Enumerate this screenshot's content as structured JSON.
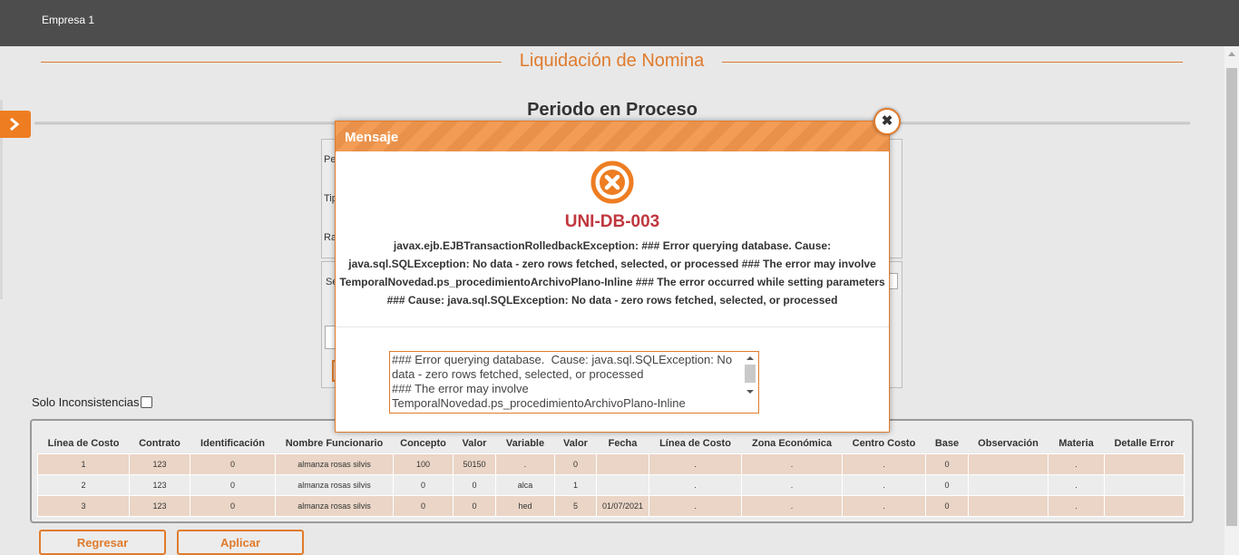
{
  "header": {
    "company": "Empresa 1"
  },
  "page": {
    "title": "Liquidación de Nomina",
    "section_title": "Periodo en Proceso"
  },
  "form_fragments": {
    "f1": "Pe",
    "f2": "Tip",
    "f3": "Ra",
    "f4": "Se"
  },
  "filter": {
    "solo_inconsistencias_label": "Solo Inconsistencias",
    "checked": false
  },
  "table": {
    "columns": [
      "Línea de Costo",
      "Contrato",
      "Identificación",
      "Nombre Funcionario",
      "Concepto",
      "Valor",
      "Variable",
      "Valor",
      "Fecha",
      "Línea de Costo",
      "Zona Económica",
      "Centro Costo",
      "Base",
      "Observación",
      "Materia",
      "Detalle Error"
    ],
    "rows": [
      [
        "1",
        "123",
        "0",
        "almanza rosas silvis",
        "100",
        "50150",
        ".",
        "0",
        "",
        ".",
        ".",
        ".",
        "0",
        "",
        ".",
        ""
      ],
      [
        "2",
        "123",
        "0",
        "almanza rosas silvis",
        "0",
        "0",
        "alca",
        "1",
        "",
        ".",
        ".",
        ".",
        "0",
        "",
        ".",
        ""
      ],
      [
        "3",
        "123",
        "0",
        "almanza rosas silvis",
        "0",
        "0",
        "hed",
        "5",
        "01/07/2021",
        ".",
        ".",
        ".",
        "0",
        "",
        ".",
        ""
      ]
    ]
  },
  "buttons": {
    "back": "Regresar",
    "apply": "Aplicar"
  },
  "modal": {
    "title": "Mensaje",
    "close_glyph": "✖",
    "error_code": "UNI-DB-003",
    "message_lines": [
      "javax.ejb.EJBTransactionRolledbackException: ### Error querying database. Cause:",
      "java.sql.SQLException: No data - zero rows fetched, selected, or processed ### The error may involve",
      "TemporalNovedad.ps_procedimientoArchivoPlano-Inline ### The error occurred while setting parameters",
      "### Cause: java.sql.SQLException: No data - zero rows fetched, selected, or processed"
    ],
    "detail_text": "### Error querying database.  Cause: java.sql.SQLException: No data - zero rows fetched, selected, or processed\n### The error may involve TemporalNovedad.ps_procedimientoArchivoPlano-Inline\n### The error occurred while setting parameters\n### Cause: java.sql.SQLException: No data - zero rows fetched, selected, or processed"
  },
  "colors": {
    "accent": "#e07b2c",
    "header_bg": "#4d4d4d",
    "error_red": "#c0373f",
    "row_odd": "#ead5c6"
  },
  "icons": {
    "sidebar_toggle": "chevron-right-icon",
    "error": "error-x-circle-icon",
    "close": "close-icon"
  }
}
